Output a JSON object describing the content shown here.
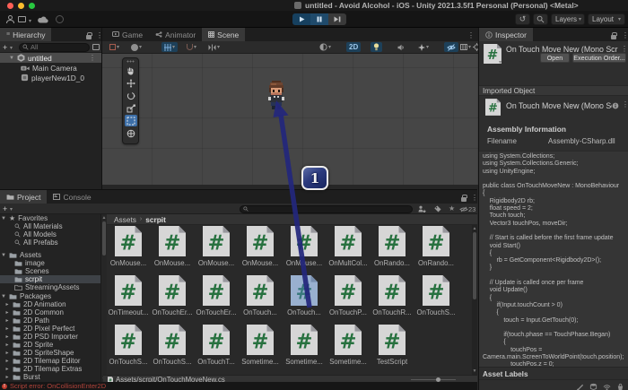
{
  "window": {
    "title": "untitled - Avoid Alcohol - iOS - Unity 2021.3.5f1 Personal (Personal) <Metal>"
  },
  "toolbar": {
    "layers": "Layers",
    "layout": "Layout"
  },
  "hierarchy": {
    "tab": "Hierarchy",
    "search_value": "All",
    "scene": "untitled",
    "items": [
      "Main Camera",
      "playerNew1D_0"
    ]
  },
  "scene": {
    "tabs": [
      "Game",
      "Animator",
      "Scene"
    ],
    "active_tab": "Scene",
    "mode_2d": "2D"
  },
  "annotation": {
    "step": "1"
  },
  "project": {
    "tabs": [
      "Project",
      "Console"
    ],
    "hidden_count": "23",
    "favorites": {
      "label": "Favorites",
      "items": [
        "All Materials",
        "All Models",
        "All Prefabs"
      ]
    },
    "assets": {
      "label": "Assets",
      "folders": [
        "image",
        "Scenes",
        "scrpit",
        "StreamingAssets"
      ],
      "selected": "scrpit"
    },
    "packages": {
      "label": "Packages",
      "folders": [
        "2D Animation",
        "2D Common",
        "2D Path",
        "2D Pixel Perfect",
        "2D PSD Importer",
        "2D Sprite",
        "2D SpriteShape",
        "2D Tilemap Editor",
        "2D Tilemap Extras",
        "Burst"
      ]
    },
    "breadcrumb": {
      "root": "Assets",
      "current": "scrpit"
    },
    "grid": {
      "items": [
        "OnMouse...",
        "OnMouse...",
        "OnMouse...",
        "OnMouse...",
        "OnMouse...",
        "OnMultCol...",
        "OnRando...",
        "OnRando...",
        "OnTimeout...",
        "OnTouchEr...",
        "OnTouchEr...",
        "OnTouch...",
        "OnTouch...",
        "OnTouchP...",
        "OnTouchR...",
        "OnTouchS...",
        "OnTouchS...",
        "OnTouchS...",
        "OnTouchT...",
        "Sometime...",
        "Sometime...",
        "Sometime...",
        "TestScript"
      ],
      "selected_index": 12
    },
    "path": "Assets/scrpit/OnTouchMoveNew.cs"
  },
  "status": {
    "error": "Script error: OnCollisionEnter2D"
  },
  "inspector": {
    "tab": "Inspector",
    "script_title": "On Touch Move New (Mono Scri",
    "open": "Open",
    "execution_order": "Execution Order...",
    "imported_object": "Imported Object",
    "assembly_information": "Assembly Information",
    "filename_label": "Filename",
    "filename_value": "Assembly-CSharp.dll",
    "asset_labels": "Asset Labels",
    "code": [
      "using System.Collections;",
      "using System.Collections.Generic;",
      "using UnityEngine;",
      "",
      "public class OnTouchMoveNew : MonoBehaviour",
      "{",
      "    Rigidbody2D rb;",
      "    float speed = 2;",
      "    Touch touch;",
      "    Vector3 touchPos, moveDir;",
      "",
      "    // Start is called before the first frame update",
      "    void Start()",
      "    {",
      "        rb = GetComponent<Rigidbody2D>();",
      "    }",
      "",
      "    // Update is called once per frame",
      "    void Update()",
      "    {",
      "        if(Input.touchCount > 0)",
      "        {",
      "            touch = Input.GetTouch(0);",
      "",
      "            if(touch.phase == TouchPhase.Began)",
      "            {",
      "                touchPos =",
      "Camera.main.ScreenToWorldPoint(touch.position);",
      "                touchPos.z = 0;"
    ]
  }
}
